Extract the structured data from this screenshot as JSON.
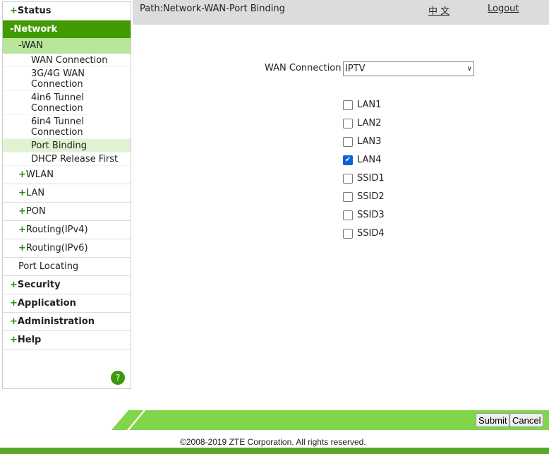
{
  "sidebar": {
    "status": "Status",
    "network": "-Network",
    "wan": "-WAN",
    "wan_items": [
      "WAN Connection",
      "3G/4G WAN Connection",
      "4in6 Tunnel Connection",
      "6in4 Tunnel Connection",
      "Port Binding",
      "DHCP Release First"
    ],
    "net_items": [
      "WLAN",
      "LAN",
      "PON",
      "Routing(IPv4)",
      "Routing(IPv6)"
    ],
    "port_locating": "Port Locating",
    "top_items": [
      "Security",
      "Application",
      "Administration",
      "Help"
    ],
    "help": "?"
  },
  "header": {
    "path": "Path:Network-WAN-Port Binding",
    "lang": "中 文",
    "logout": "Logout"
  },
  "form": {
    "wan_label": "WAN Connection",
    "wan_value": "IPTV",
    "ports": [
      {
        "label": "LAN1",
        "checked": false
      },
      {
        "label": "LAN2",
        "checked": false
      },
      {
        "label": "LAN3",
        "checked": false
      },
      {
        "label": "LAN4",
        "checked": true
      },
      {
        "label": "SSID1",
        "checked": false
      },
      {
        "label": "SSID2",
        "checked": false
      },
      {
        "label": "SSID3",
        "checked": false
      },
      {
        "label": "SSID4",
        "checked": false
      }
    ]
  },
  "footer": {
    "submit": "Submit",
    "cancel": "Cancel",
    "copyright": "©2008-2019 ZTE Corporation. All rights reserved."
  },
  "colors": {
    "accent": "#409c00",
    "bar": "#80d54a"
  }
}
